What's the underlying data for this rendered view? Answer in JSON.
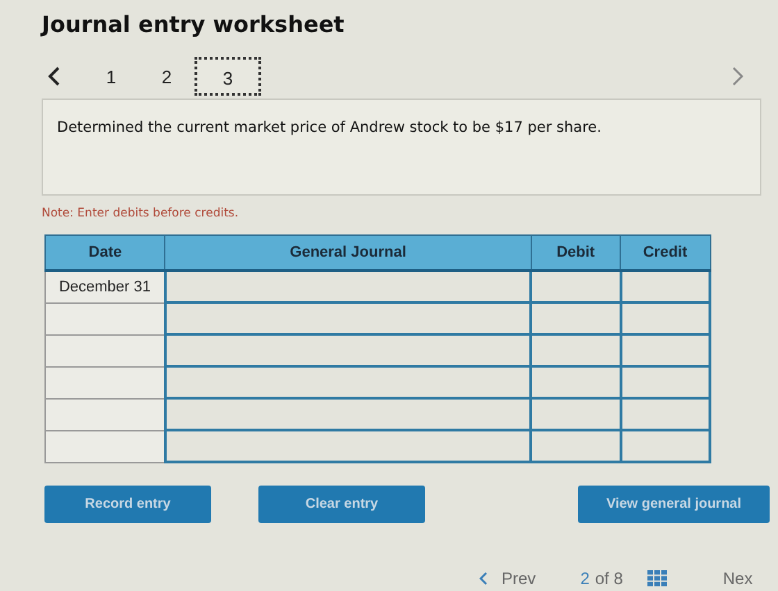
{
  "title": "Journal entry worksheet",
  "steps": [
    {
      "label": "1",
      "selected": false
    },
    {
      "label": "2",
      "selected": false
    },
    {
      "label": "3",
      "selected": true
    }
  ],
  "description": "Determined the current market price of Andrew stock to be $17 per share.",
  "note": "Note: Enter debits before credits.",
  "table": {
    "columns": [
      "Date",
      "General Journal",
      "Debit",
      "Credit"
    ],
    "rows": [
      {
        "date": "December 31"
      },
      {},
      {},
      {},
      {},
      {}
    ]
  },
  "buttons": [
    "Record entry",
    "Clear entry",
    "View general journal"
  ],
  "footer": {
    "prev": "Prev",
    "page": "2",
    "total": "of 8",
    "next": "Nex"
  }
}
